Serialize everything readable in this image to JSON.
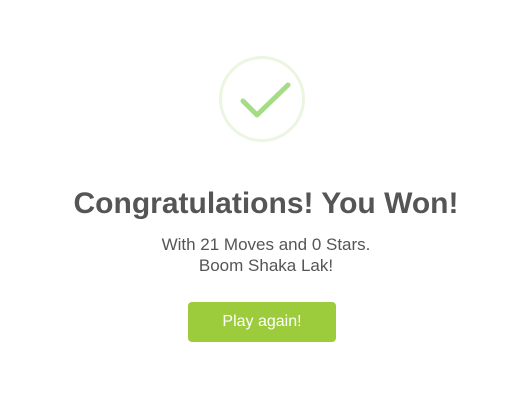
{
  "win_dialog": {
    "icon": "check-icon",
    "title": "Congratulations! You Won!",
    "message_line_1": "With 21 Moves and 0 Stars.",
    "message_line_2": "Boom Shaka Lak!",
    "play_again_label": "Play again!"
  },
  "colors": {
    "accent_green": "#9ccb3b",
    "check_stroke": "#a5dc86",
    "ring": "#eaf6e2",
    "text": "#555555"
  }
}
